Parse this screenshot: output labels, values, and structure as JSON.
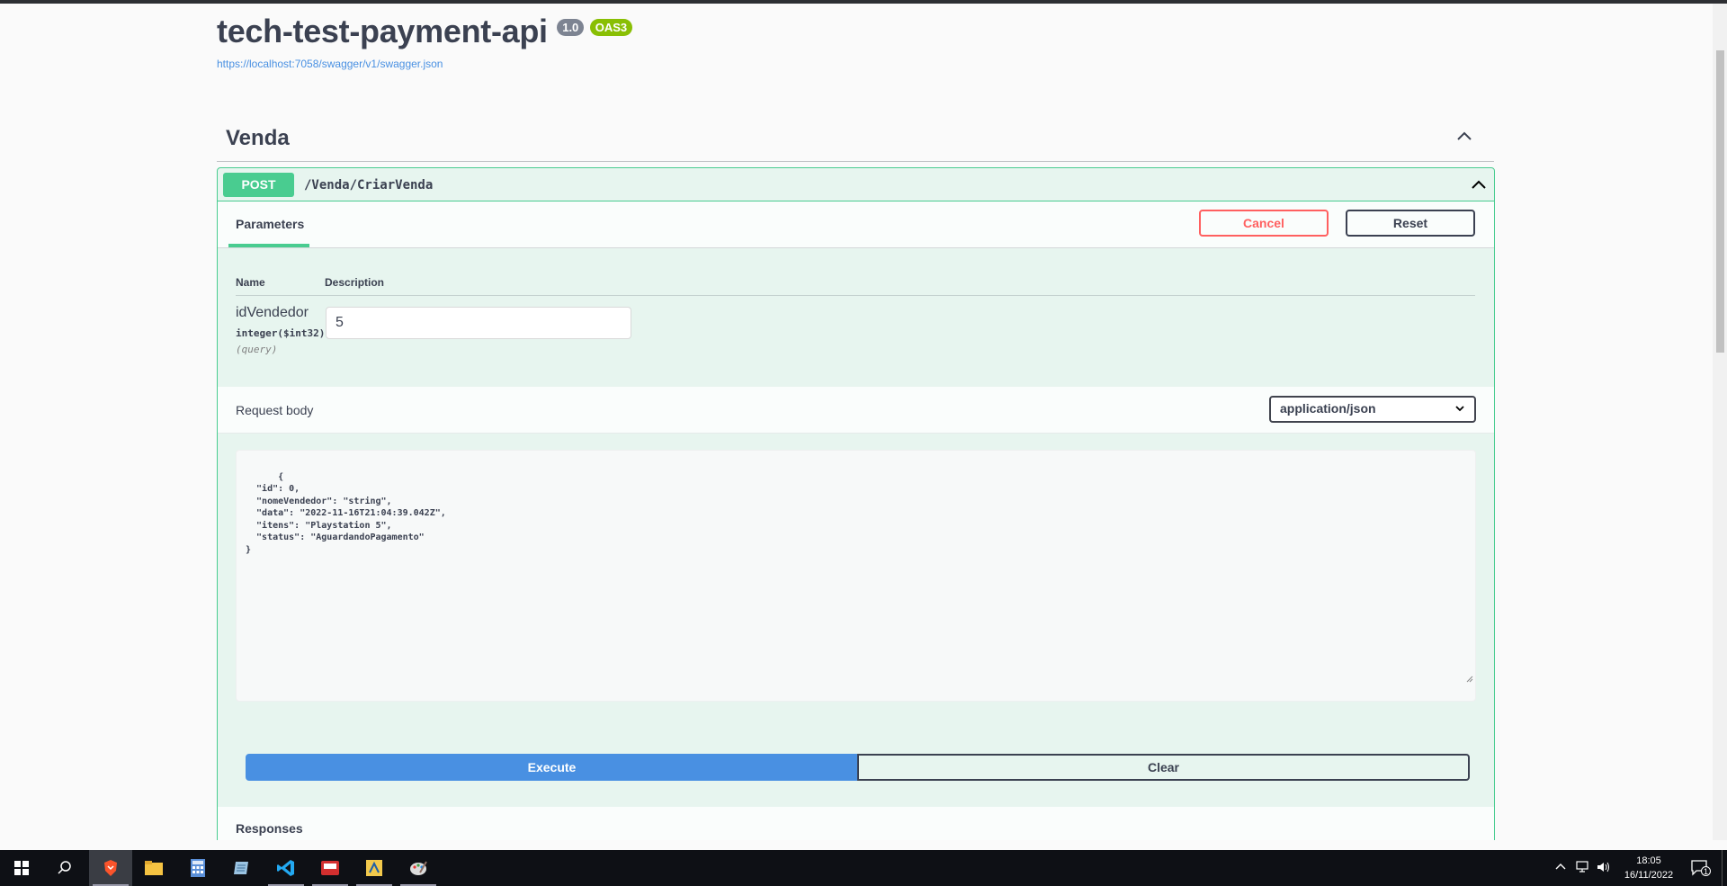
{
  "app": {
    "title": "tech-test-payment-api",
    "version": "1.0",
    "oas": "OAS3",
    "spec_url": "https://localhost:7058/swagger/v1/swagger.json"
  },
  "tag": {
    "name": "Venda"
  },
  "operation": {
    "method": "POST",
    "path": "/Venda/CriarVenda",
    "tab_label": "Parameters",
    "cancel_label": "Cancel",
    "reset_label": "Reset",
    "table_headers": {
      "name": "Name",
      "description": "Description"
    },
    "param": {
      "name": "idVendedor",
      "type": "integer($int32)",
      "in": "(query)",
      "value": "5"
    },
    "request_body": {
      "title": "Request body",
      "content_type": "application/json",
      "body": "{\n  \"id\": 0,\n  \"nomeVendedor\": \"string\",\n  \"data\": \"2022-11-16T21:04:39.042Z\",\n  \"itens\": \"Playstation 5\",\n  \"status\": \"AguardandoPagamento\"\n}"
    },
    "execute_label": "Execute",
    "clear_label": "Clear",
    "responses_title": "Responses"
  },
  "taskbar": {
    "time": "18:05",
    "date": "16/11/2022",
    "notification_count": "1",
    "apps": [
      "start-icon",
      "search-icon",
      "brave-browser-icon",
      "file-explorer-icon",
      "calculator-icon",
      "notepad-icon",
      "vscode-icon",
      "app-red-icon",
      "app-yellow-icon",
      "app-paint-icon"
    ]
  }
}
